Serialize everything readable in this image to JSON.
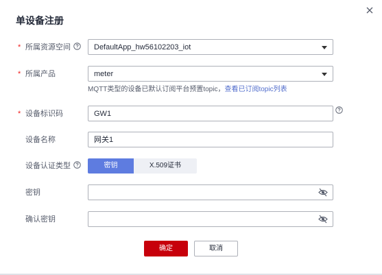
{
  "dialog": {
    "title": "单设备注册"
  },
  "fields": {
    "resource_space": {
      "label": "所属资源空间",
      "value": "DefaultApp_hw56102203_iot"
    },
    "product": {
      "label": "所属产品",
      "value": "meter"
    },
    "hint_text": "MQTT类型的设备已默认订阅平台预置topic，",
    "hint_link": "查看已订阅topic列表",
    "node_id": {
      "label": "设备标识码",
      "value": "GW1"
    },
    "device_name": {
      "label": "设备名称",
      "value": "网关1"
    },
    "auth_type": {
      "label": "设备认证类型",
      "options": [
        "密钥",
        "X.509证书"
      ],
      "selected": "密钥"
    },
    "secret": {
      "label": "密钥",
      "value": ""
    },
    "confirm_secret": {
      "label": "确认密钥",
      "value": ""
    }
  },
  "required_mark": "*",
  "footer": {
    "ok_label": "确定",
    "cancel_label": "取消"
  },
  "colors": {
    "primary": "#c7000b",
    "accent": "#5e7ce0",
    "link": "#526ecc"
  },
  "icons": {
    "close": "close-icon",
    "help": "help-circle-icon",
    "eye": "eye-slash-icon",
    "dropdown": "caret-down-icon"
  }
}
